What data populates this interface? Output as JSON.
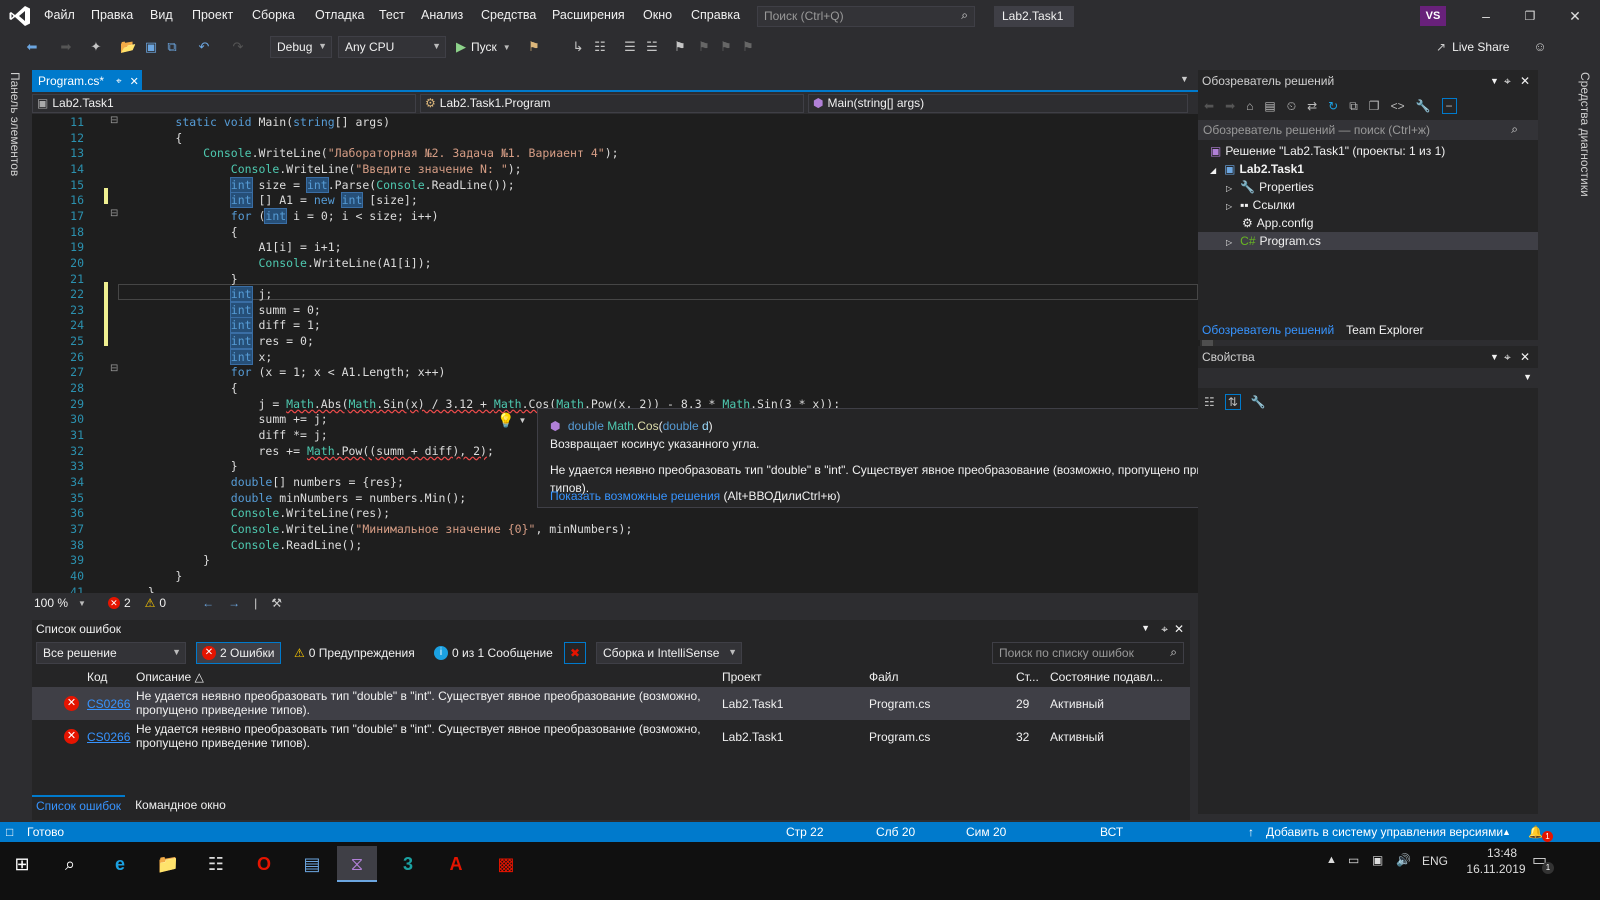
{
  "menu": {
    "items": [
      "Файл",
      "Правка",
      "Вид",
      "Проект",
      "Сборка",
      "Отладка",
      "Тест",
      "Анализ",
      "Средства",
      "Расширения",
      "Окно",
      "Справка"
    ],
    "search_placeholder": "Поиск (Ctrl+Q)",
    "solution_title": "Lab2.Task1",
    "avatar": "VS",
    "live_share": "Live Share"
  },
  "toolbar": {
    "config": "Debug",
    "platform": "Any CPU",
    "run_label": "Пуск"
  },
  "left_strip": "Панель элементов",
  "right_strip": "Средства диагностики",
  "doc_tab": {
    "label": "Program.cs*"
  },
  "navbar": {
    "project": "Lab2.Task1",
    "type": "Lab2.Task1.Program",
    "member": "Main(string[] args)"
  },
  "code": {
    "lines": [
      {
        "n": "11",
        "t": "        static void Main(string[] args)"
      },
      {
        "n": "12",
        "t": "        {"
      },
      {
        "n": "13",
        "t": "            Console.WriteLine(\"Лабораторная №2. Задача №1. Вариаент 4\");"
      },
      {
        "n": "14",
        "t": "                Console.WriteLine(\"Введите значение N: \");"
      },
      {
        "n": "15",
        "t": "                int size = int.Parse(Console.ReadLine());"
      },
      {
        "n": "16",
        "t": "                int [] A1 = new int [size];"
      },
      {
        "n": "17",
        "t": "                for (int i = 0; i < size; i++)"
      },
      {
        "n": "18",
        "t": "                {"
      },
      {
        "n": "19",
        "t": "                    A1[i] = i+1;"
      },
      {
        "n": "20",
        "t": "                    Console.WriteLine(A1[i]);"
      },
      {
        "n": "21",
        "t": "                }"
      },
      {
        "n": "22",
        "t": "                int j;"
      },
      {
        "n": "23",
        "t": "                int summ = 0;"
      },
      {
        "n": "24",
        "t": "                int diff = 1;"
      },
      {
        "n": "25",
        "t": "                int res = 0;"
      },
      {
        "n": "26",
        "t": "                int x;"
      },
      {
        "n": "27",
        "t": "                for (x = 1; x < A1.Length; x++)"
      },
      {
        "n": "28",
        "t": "                {"
      },
      {
        "n": "29",
        "t": "                    j = Math.Abs(Math.Sin(x) / 3.12 + Math.Cos(Math.Pow(x, 2)) - 8.3 * Math.Sin(3 * x));"
      },
      {
        "n": "30",
        "t": "                    summ += j;"
      },
      {
        "n": "31",
        "t": "                    diff *= j;"
      },
      {
        "n": "32",
        "t": "                    res += Math.Pow((summ + diff), 2);"
      },
      {
        "n": "33",
        "t": "                }"
      },
      {
        "n": "34",
        "t": "                double[] numbers = {res};"
      },
      {
        "n": "35",
        "t": "                double minNumbers = numbers.Min();"
      },
      {
        "n": "36",
        "t": "                Console.WriteLine(res);"
      },
      {
        "n": "37",
        "t": "                Console.WriteLine(\"Минимальное значение {0}\", minNumbers);"
      },
      {
        "n": "38",
        "t": "                Console.ReadLine();"
      },
      {
        "n": "39",
        "t": "            }"
      },
      {
        "n": "40",
        "t": "        }"
      },
      {
        "n": "41",
        "t": "    }"
      }
    ]
  },
  "editor_status": {
    "zoom": "100 %",
    "errors": "2",
    "warnings": "0"
  },
  "tooltip": {
    "signature_prefix": "double",
    "signature_class": "Math",
    "signature_method": "Cos",
    "signature_param_type": "double",
    "signature_param_name": "d",
    "description": "Возвращает косинус указанного угла.",
    "error_message": "Не удается неявно преобразовать тип \"double\" в \"int\". Существует явное преобразование (возможно, пропущено приведение типов).",
    "fix_link": "Показать возможные решения",
    "fix_shortcut": "(Alt+ВВОДилиCtrl+ю)"
  },
  "error_list": {
    "title": "Список ошибок",
    "scope": "Все решение",
    "errors_btn": "2 Ошибки",
    "warnings_btn": "0 Предупреждения",
    "messages_btn": "0 из 1 Сообщение",
    "source": "Сборка и IntelliSense",
    "search_placeholder": "Поиск по списку ошибок",
    "columns": [
      "Код",
      "Описание",
      "Проект",
      "Файл",
      "Ст...",
      "Состояние подавл..."
    ],
    "rows": [
      {
        "code": "CS0266",
        "desc1": "Не удается неявно преобразовать тип \"double\" в \"int\". Существует явное преобразование (возможно,",
        "desc2": "пропущено приведение типов).",
        "project": "Lab2.Task1",
        "file": "Program.cs",
        "line": "29",
        "state": "Активный"
      },
      {
        "code": "CS0266",
        "desc1": "Не удается неявно преобразовать тип \"double\" в \"int\". Существует явное преобразование (возможно,",
        "desc2": "пропущено приведение типов).",
        "project": "Lab2.Task1",
        "file": "Program.cs",
        "line": "32",
        "state": "Активный"
      }
    ],
    "bottom_tabs": [
      "Список ошибок",
      "Командное окно"
    ]
  },
  "solution_explorer": {
    "title": "Обозреватель решений",
    "search_placeholder": "Обозреватель решений — поиск (Ctrl+ж)",
    "solution": "Решение \"Lab2.Task1\" (проекты: 1 из 1)",
    "project": "Lab2.Task1",
    "items": [
      "Properties",
      "Ссылки",
      "App.config",
      "Program.cs"
    ],
    "tabs": [
      "Обозреватель решений",
      "Team Explorer"
    ]
  },
  "properties": {
    "title": "Свойства"
  },
  "statusbar": {
    "ready": "Готово",
    "line": "Стр 22",
    "col": "Слб 20",
    "ch": "Сим 20",
    "mode": "ВСТ",
    "vcs": "Добавить в систему управления версиями",
    "notif": "1"
  },
  "taskbar": {
    "lang": "ENG",
    "time": "13:48",
    "date": "16.11.2019",
    "notif": "1"
  }
}
